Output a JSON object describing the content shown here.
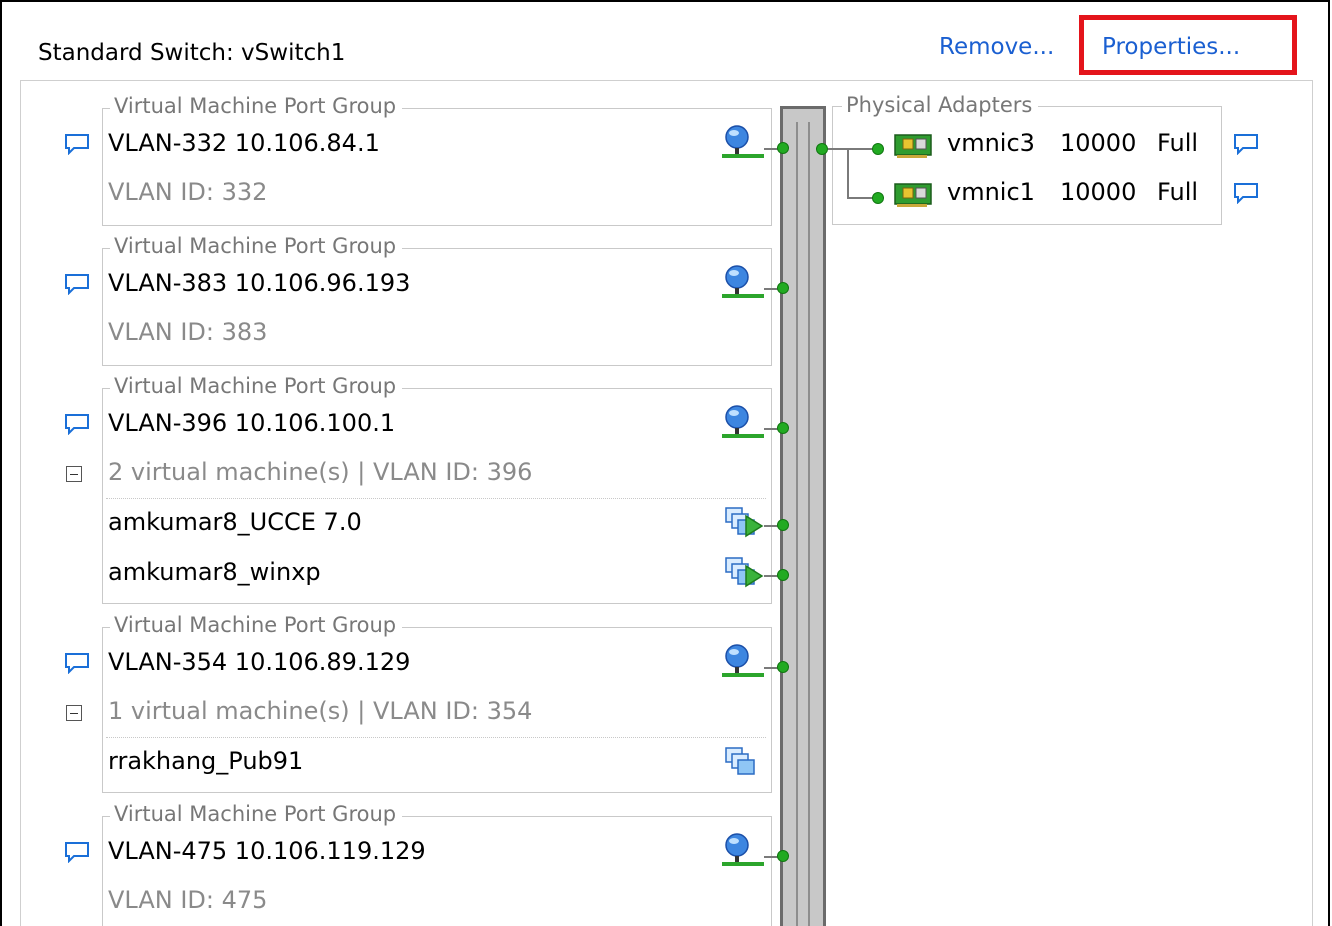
{
  "switch": {
    "title": "Standard Switch: vSwitch1",
    "remove_label": "Remove...",
    "properties_label": "Properties..."
  },
  "port_groups": [
    {
      "legend": "Virtual Machine Port Group",
      "name": "VLAN-332 10.106.84.1",
      "info": "VLAN ID: 332",
      "vms": []
    },
    {
      "legend": "Virtual Machine Port Group",
      "name": "VLAN-383 10.106.96.193",
      "info": "VLAN ID: 383",
      "vms": []
    },
    {
      "legend": "Virtual Machine Port Group",
      "name": "VLAN-396 10.106.100.1",
      "info": "2 virtual machine(s) | VLAN ID: 396",
      "vms": [
        "amkumar8_UCCE 7.0",
        "amkumar8_winxp"
      ]
    },
    {
      "legend": "Virtual Machine Port Group",
      "name": "VLAN-354 10.106.89.129",
      "info": "1 virtual machine(s) | VLAN ID: 354",
      "vms": [
        "rrakhang_Pub91"
      ]
    },
    {
      "legend": "Virtual Machine Port Group",
      "name": "VLAN-475 10.106.119.129",
      "info": "VLAN ID: 475",
      "vms": []
    }
  ],
  "physical_adapters": {
    "legend": "Physical Adapters",
    "adapters": [
      {
        "name": "vmnic3",
        "speed": "10000",
        "duplex": "Full"
      },
      {
        "name": "vmnic1",
        "speed": "10000",
        "duplex": "Full"
      }
    ]
  },
  "icons": {
    "info": "speech-bubble-icon",
    "network": "globe-network-icon",
    "vm": "virtual-machine-icon",
    "nic": "network-card-icon",
    "collapse": "collapse-minus-icon"
  },
  "colors": {
    "link": "#1a5fd1",
    "highlight": "#e4141b",
    "port_dot": "#22aa22",
    "bubble": "#1a6fd8"
  }
}
